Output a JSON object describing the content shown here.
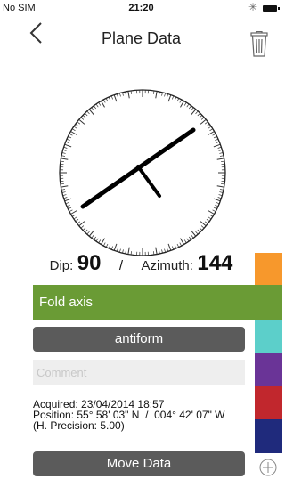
{
  "status_bar": {
    "carrier": "No SIM",
    "time": "21:20",
    "bluetooth_icon": "bluetooth-icon",
    "battery_icon": "battery-icon"
  },
  "nav": {
    "title": "Plane Data",
    "back_icon": "chevron-left-icon",
    "delete_icon": "trash-icon"
  },
  "measurement": {
    "dip_label": "Dip:",
    "dip_value": "90",
    "separator": "/",
    "azimuth_label": "Azimuth:",
    "azimuth_value": "144"
  },
  "classification": {
    "label": "Fold axis",
    "color": "#6a9b35"
  },
  "structure_button": {
    "label": "antiform"
  },
  "comment": {
    "placeholder": "Comment",
    "value": ""
  },
  "info": {
    "acquired": "Acquired: 23/04/2014 18:57",
    "position": "Position: 55° 58' 03\" N  /  004° 42' 07\" W",
    "precision": "(H. Precision: 5.00)"
  },
  "move_button": {
    "label": "Move Data"
  },
  "palette": [
    "#f7982c",
    "#6a9b35",
    "#5ccfca",
    "#6a3497",
    "#c1272d",
    "#1f2a7c"
  ],
  "add_icon": "plus-circle-icon"
}
